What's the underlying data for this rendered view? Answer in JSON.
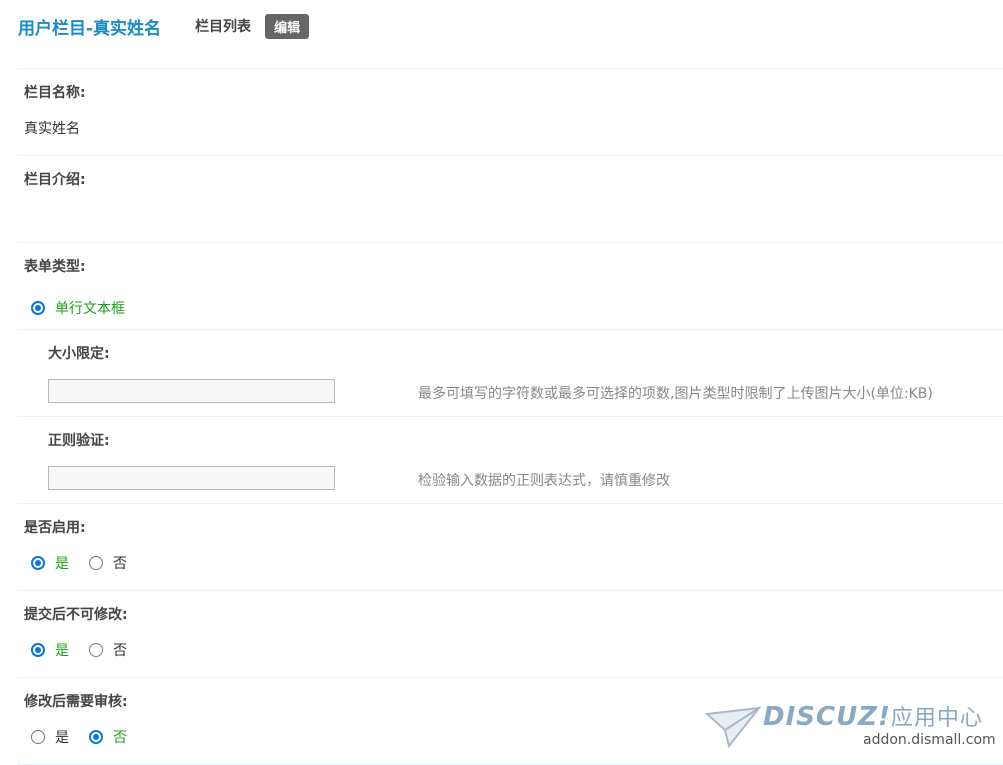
{
  "header": {
    "title": "用户栏目-真实姓名",
    "tab_list": "栏目列表",
    "tab_edit": "编辑"
  },
  "fields": {
    "name": {
      "label": "栏目名称:",
      "value": "真实姓名"
    },
    "intro": {
      "label": "栏目介绍:"
    },
    "form_type": {
      "label": "表单类型:",
      "option": "单行文本框"
    },
    "size_limit": {
      "label": "大小限定:",
      "value": "",
      "tip": "最多可填写的字符数或最多可选择的项数,图片类型时限制了上传图片大小(单位:KB)"
    },
    "regex": {
      "label": "正则验证:",
      "value": "",
      "tip": "检验输入数据的正则表达式，请慎重修改"
    },
    "enabled": {
      "label": "是否启用:",
      "yes": "是",
      "no": "否",
      "selected": "yes"
    },
    "locked": {
      "label": "提交后不可修改:",
      "yes": "是",
      "no": "否",
      "selected": "yes"
    },
    "review": {
      "label": "修改后需要审核:",
      "yes": "是",
      "no": "否",
      "selected": "no"
    }
  },
  "watermark": {
    "brand": "DISCUZ!",
    "brand_cn": "应用中心",
    "url": "addon.dismall.com"
  },
  "colors": {
    "title": "#1b8bc3",
    "accent": "#0b74e5",
    "selected_text": "#19a219"
  }
}
